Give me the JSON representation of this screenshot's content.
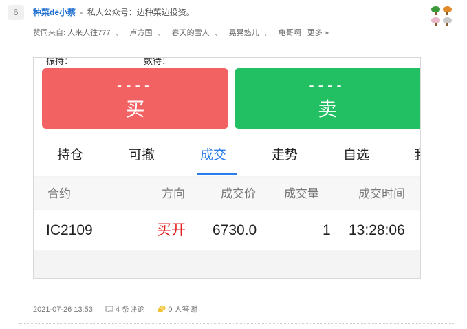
{
  "answer": {
    "rank": "6",
    "author": "种菜de小蔡",
    "separator": "-",
    "bio": "私人公众号：边种菜边投资。",
    "likes_prefix": "赞同来自:",
    "likers": [
      "人来人往777",
      "卢方国",
      "春天的雪人",
      "晃晃悠儿",
      "龟哥啊"
    ],
    "more": "更多 »",
    "timestamp": "2021-07-26 13:53",
    "comments": "4 条评论",
    "thanks": "0 人答谢"
  },
  "badges": {
    "colors": [
      "#3a9a3a",
      "#e08a2a",
      "#e8b8c8",
      "#c8c8c8"
    ]
  },
  "screenshot": {
    "cut_text_left": "振持：",
    "cut_text_right": "数待：",
    "buy": {
      "price": "----",
      "label": "买"
    },
    "sell": {
      "price": "----",
      "label": "卖"
    },
    "tabs": [
      "持仓",
      "可撤",
      "成交",
      "走势",
      "自选"
    ],
    "active_tab": "成交",
    "tab_clipped": "我",
    "columns": [
      "合约",
      "方向",
      "成交价",
      "成交量",
      "成交时间"
    ],
    "row": {
      "contract": "IC2109",
      "direction": "买开",
      "price": "6730.0",
      "volume": "1",
      "time": "13:28:06"
    },
    "colors": {
      "buy": "#f26262",
      "sell": "#22c063",
      "active_tab": "#2b7de9",
      "direction": "#e02020"
    }
  }
}
